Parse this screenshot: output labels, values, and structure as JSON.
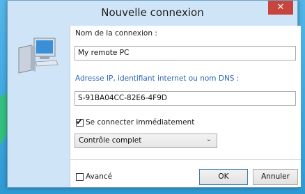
{
  "dialog": {
    "title": "Nouvelle connexion",
    "close_glyph": "✕"
  },
  "form": {
    "name_label": "Nom de la connexion :",
    "name_value": "My remote PC",
    "address_label": "Adresse IP, identifiant internet ou nom DNS :",
    "address_value": "S-91BA04CC-82E6-4F9D",
    "connect_label": "Se connecter immédiatement",
    "connect_checked": true,
    "mode_value": "Contrôle complet",
    "advanced_label": "Avancé",
    "advanced_checked": false
  },
  "buttons": {
    "ok": "OK",
    "cancel": "Annuler"
  },
  "icons": {
    "computer": "computer-icon",
    "close": "close-icon",
    "chevron": "chevron-down-icon",
    "check": "checkmark-icon"
  },
  "colors": {
    "background": "#3aa6dd",
    "title_bar": "#cfe4f6",
    "close_button": "#c7453c",
    "accent_label": "#2a64b8",
    "arrow": "#34c07a"
  }
}
